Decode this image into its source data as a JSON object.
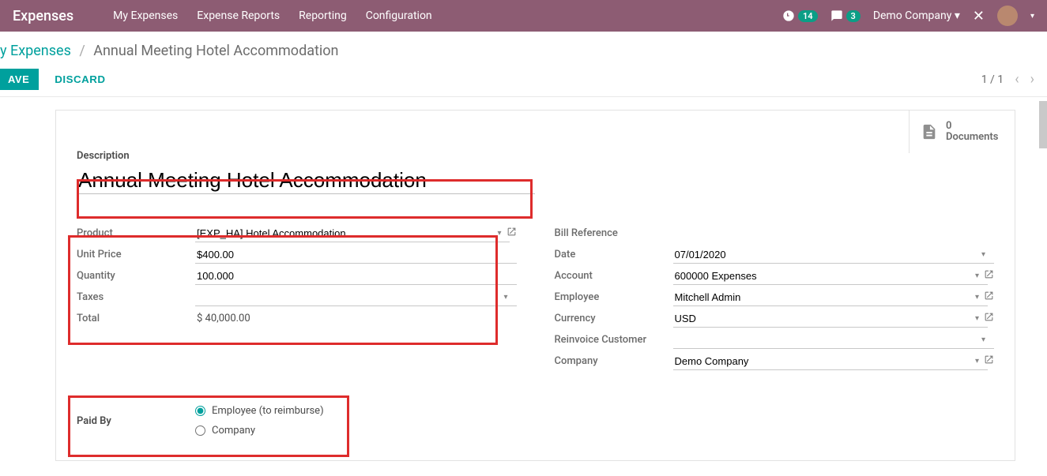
{
  "topbar": {
    "app": "Expenses",
    "nav": [
      "My Expenses",
      "Expense Reports",
      "Reporting",
      "Configuration"
    ],
    "clock_badge": "14",
    "chat_badge": "3",
    "company": "Demo Company"
  },
  "breadcrumb": {
    "prefix_visible": "y Expenses",
    "current": "Annual Meeting Hotel Accommodation"
  },
  "actions": {
    "save": "AVE",
    "discard": "DISCARD",
    "pager": "1 / 1"
  },
  "documents": {
    "count": "0",
    "label": "Documents"
  },
  "form": {
    "description_label": "Description",
    "description_value": "Annual Meeting Hotel Accommodation",
    "left": {
      "product_label": "Product",
      "product_value": "[EXP_HA] Hotel Accommodation",
      "unit_price_label": "Unit Price",
      "unit_price_value": "$400.00",
      "quantity_label": "Quantity",
      "quantity_value": "100.000",
      "taxes_label": "Taxes",
      "taxes_value": "",
      "total_label": "Total",
      "total_value": "$ 40,000.00"
    },
    "right": {
      "bill_ref_label": "Bill Reference",
      "date_label": "Date",
      "date_value": "07/01/2020",
      "account_label": "Account",
      "account_value": "600000 Expenses",
      "employee_label": "Employee",
      "employee_value": "Mitchell Admin",
      "currency_label": "Currency",
      "currency_value": "USD",
      "reinvoice_label": "Reinvoice Customer",
      "reinvoice_value": "",
      "company_label": "Company",
      "company_value": "Demo Company"
    },
    "paid_by": {
      "label": "Paid By",
      "opt1": "Employee (to reimburse)",
      "opt2": "Company"
    }
  }
}
